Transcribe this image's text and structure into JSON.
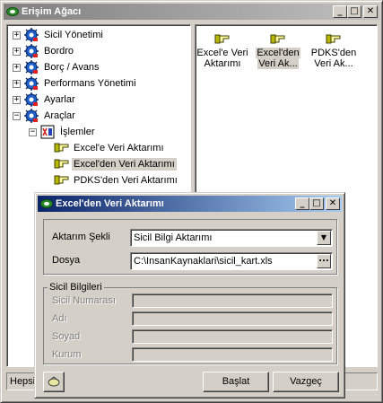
{
  "main_window": {
    "title": "Erişim Ağacı",
    "title_buttons": [
      "_",
      "□",
      "✕"
    ],
    "tree": [
      {
        "label": "Sicil Yönetimi",
        "expander": "+"
      },
      {
        "label": "Bordro",
        "expander": "+"
      },
      {
        "label": "Borç / Avans",
        "expander": "+"
      },
      {
        "label": "Performans Yönetimi",
        "expander": "+"
      },
      {
        "label": "Ayarlar",
        "expander": "+"
      },
      {
        "label": "Araçlar",
        "expander": "−"
      },
      {
        "label": "İşlemler",
        "expander": "−"
      },
      {
        "label": "Excel'e Veri Aktarımı"
      },
      {
        "label": "Excel'den Veri Aktarımı",
        "selected": true
      },
      {
        "label": "PDKS'den Veri Aktarımı"
      }
    ],
    "right_items": [
      {
        "line1": "Excel'e Veri",
        "line2": "Aktarımı"
      },
      {
        "line1": "Excel'den",
        "line2": "Veri Ak...",
        "selected": true
      },
      {
        "line1": "PDKS'den",
        "line2": "Veri Ak..."
      }
    ],
    "status_text": "Hepsi"
  },
  "dialog": {
    "title": "Excel'den Veri Aktarımı",
    "title_buttons": [
      "_",
      "□",
      "✕"
    ],
    "transfer_type_label": "Aktarım Şekli",
    "transfer_type_value": "Sicil Bilgi Aktarımı",
    "file_label": "Dosya",
    "file_value": "C:\\InsanKaynaklari\\sicil_kart.xls",
    "ellipsis_label": "...",
    "group_title": "Sicil Bilgileri",
    "fields": [
      {
        "label": "Sicil Numarası",
        "value": ""
      },
      {
        "label": "Adı",
        "value": ""
      },
      {
        "label": "Soyad",
        "value": ""
      },
      {
        "label": "Kurum",
        "value": ""
      }
    ],
    "start_button": "Başlat",
    "cancel_button": "Vazgeç"
  },
  "colors": {
    "active_title": "#0a246a",
    "inactive_title": "#808080",
    "face": "#d4d0c8"
  }
}
